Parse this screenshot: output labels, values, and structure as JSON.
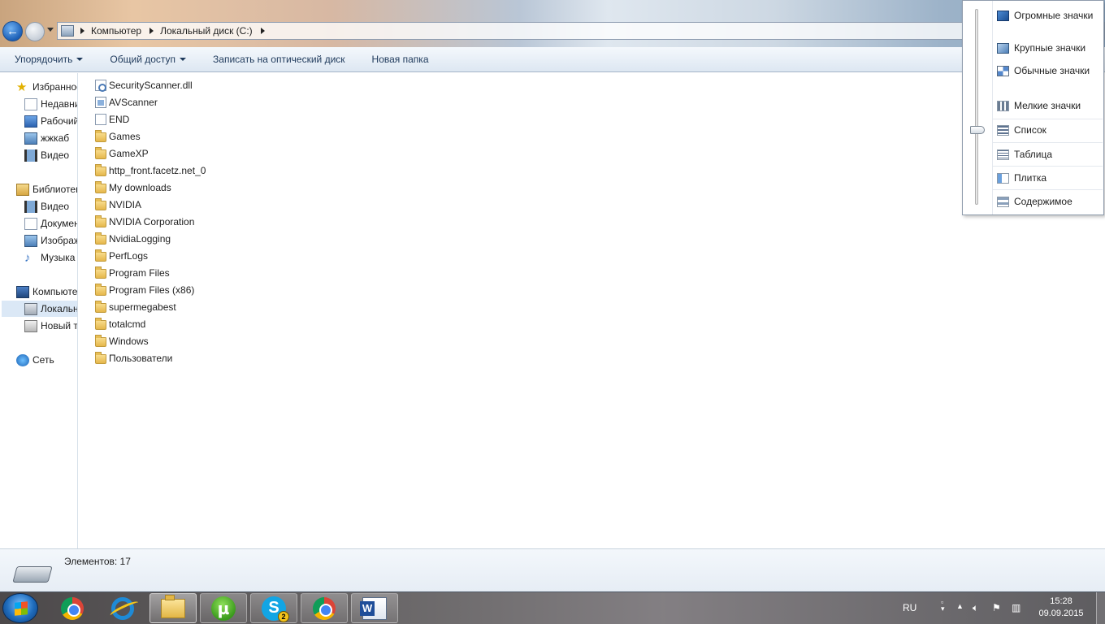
{
  "address": {
    "crumbs": [
      "Компьютер",
      "Локальный диск (C:)"
    ]
  },
  "toolbar": {
    "organize": "Упорядочить",
    "share": "Общий доступ",
    "burn": "Записать на оптический диск",
    "new_folder": "Новая папка"
  },
  "sidebar": {
    "favorites": "Избранное",
    "recent": "Недавние места",
    "desktop": "Рабочий стол",
    "custom": "жжкаб",
    "video_fav": "Видео",
    "libraries": "Библиотеки",
    "lib_video": "Видео",
    "lib_docs": "Документы",
    "lib_images": "Изображения",
    "lib_music": "Музыка",
    "computer": "Компьютер",
    "local_disk": "Локальный диск (C:)",
    "new_volume": "Новый том",
    "network": "Сеть"
  },
  "files": [
    {
      "name": "SecurityScanner.dll",
      "type": "dll"
    },
    {
      "name": "AVScanner",
      "type": "exe"
    },
    {
      "name": "END",
      "type": "blank"
    },
    {
      "name": "Games",
      "type": "folder"
    },
    {
      "name": "GameXP",
      "type": "folder"
    },
    {
      "name": "http_front.facetz.net_0",
      "type": "folder"
    },
    {
      "name": "My downloads",
      "type": "folder"
    },
    {
      "name": "NVIDIA",
      "type": "folder"
    },
    {
      "name": "NVIDIA Corporation",
      "type": "folder"
    },
    {
      "name": "NvidiaLogging",
      "type": "folder"
    },
    {
      "name": "PerfLogs",
      "type": "folder"
    },
    {
      "name": "Program Files",
      "type": "folder"
    },
    {
      "name": "Program Files (x86)",
      "type": "folder"
    },
    {
      "name": "supermegabest",
      "type": "folder"
    },
    {
      "name": "totalcmd",
      "type": "folder"
    },
    {
      "name": "Windows",
      "type": "folder"
    },
    {
      "name": "Пользователи",
      "type": "folder"
    }
  ],
  "status": {
    "count": "Элементов: 17"
  },
  "view_menu": {
    "huge": "Огромные значки",
    "large": "Крупные значки",
    "normal": "Обычные значки",
    "small": "Мелкие значки",
    "list": "Список",
    "table": "Таблица",
    "tiles": "Плитка",
    "content": "Содержимое",
    "current": "Список"
  },
  "taskbar": {
    "skype_badge": "2"
  },
  "tray": {
    "lang": "RU",
    "time": "15:28",
    "date": "09.09.2015"
  }
}
